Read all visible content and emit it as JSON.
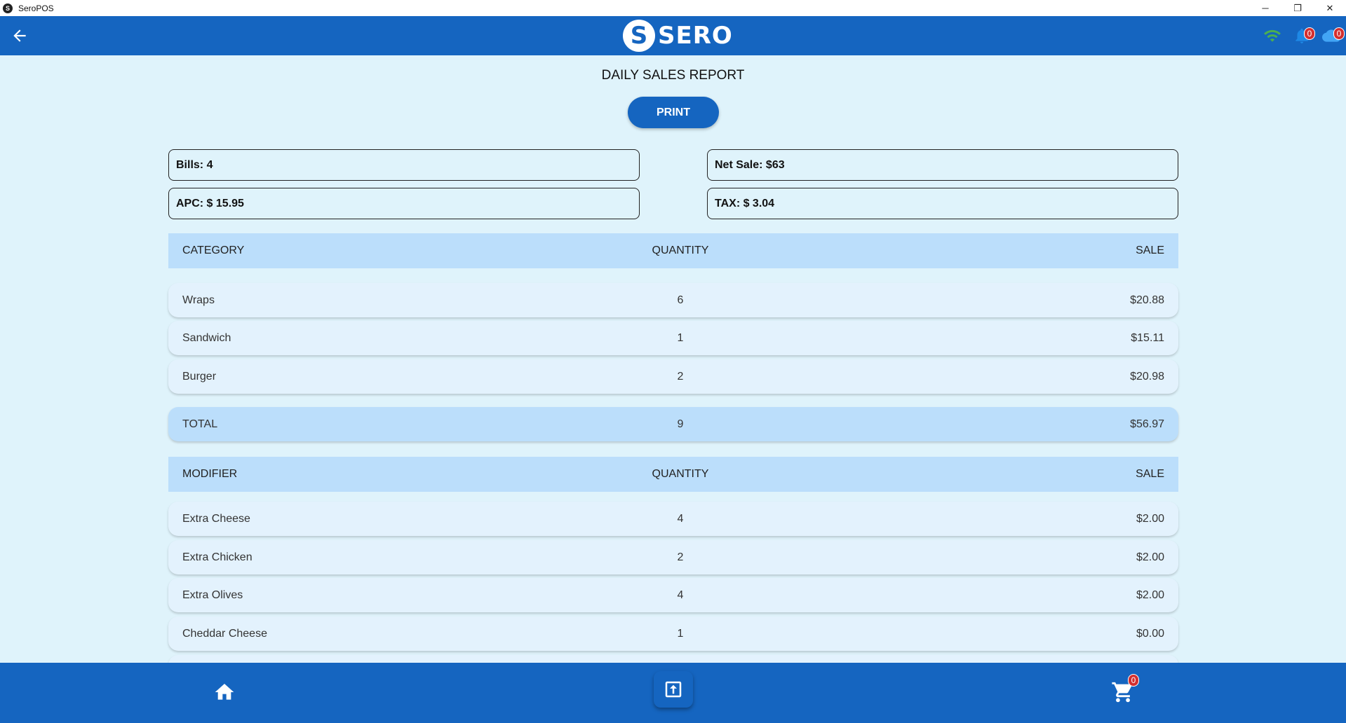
{
  "window": {
    "title": "SeroPOS",
    "app_icon_glyph": "S",
    "minimize_glyph": "─",
    "restore_glyph": "❐",
    "close_glyph": "✕"
  },
  "header": {
    "logo_mark": "S",
    "logo_text": "SERO",
    "wifi_color": "#4caf50",
    "notification_count": "0",
    "cloud_count": "0",
    "brand_color": "#1565c0"
  },
  "report": {
    "title": "DAILY SALES REPORT",
    "print_label": "PRINT",
    "bills": "Bills: 4",
    "net_sale": "Net Sale: $63",
    "apc": "APC: $ 15.95",
    "tax": "TAX: $ 3.04"
  },
  "category_table": {
    "headers": [
      "CATEGORY",
      "QUANTITY",
      "SALE"
    ],
    "rows": [
      {
        "name": "Wraps",
        "qty": "6",
        "sale": "$20.88"
      },
      {
        "name": "Sandwich",
        "qty": "1",
        "sale": "$15.11"
      },
      {
        "name": "Burger",
        "qty": "2",
        "sale": "$20.98"
      }
    ],
    "total": {
      "name": "TOTAL",
      "qty": "9",
      "sale": "$56.97"
    }
  },
  "modifier_table": {
    "headers": [
      "MODIFIER",
      "QUANTITY",
      "SALE"
    ],
    "rows": [
      {
        "name": "Extra Cheese",
        "qty": "4",
        "sale": "$2.00"
      },
      {
        "name": "Extra Chicken",
        "qty": "2",
        "sale": "$2.00"
      },
      {
        "name": "Extra Olives",
        "qty": "4",
        "sale": "$2.00"
      },
      {
        "name": "Cheddar Cheese",
        "qty": "1",
        "sale": "$0.00"
      }
    ]
  },
  "bottom_nav": {
    "cart_count": "0"
  }
}
